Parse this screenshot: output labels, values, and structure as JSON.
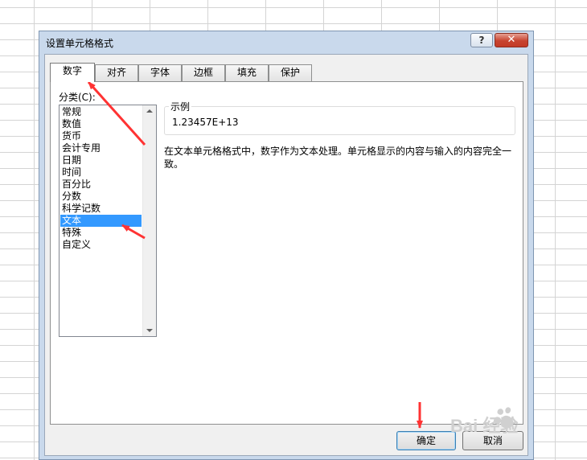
{
  "dialog": {
    "title": "设置单元格格式",
    "help_label": "?",
    "close_label": "✕"
  },
  "tabs": [
    {
      "label": "数字",
      "active": true
    },
    {
      "label": "对齐",
      "active": false
    },
    {
      "label": "字体",
      "active": false
    },
    {
      "label": "边框",
      "active": false
    },
    {
      "label": "填充",
      "active": false
    },
    {
      "label": "保护",
      "active": false
    }
  ],
  "category": {
    "label": "分类(C):",
    "items": [
      "常规",
      "数值",
      "货币",
      "会计专用",
      "日期",
      "时间",
      "百分比",
      "分数",
      "科学记数",
      "文本",
      "特殊",
      "自定义"
    ],
    "selected": "文本"
  },
  "sample": {
    "legend": "示例",
    "value": "1.23457E+13"
  },
  "description": "在文本单元格格式中，数字作为文本处理。单元格显示的内容与输入的内容完全一致。",
  "buttons": {
    "ok": "确定",
    "cancel": "取消"
  },
  "colors": {
    "selection": "#3399ff",
    "annotation_arrow": "#ff3333",
    "dialog_frame": "#c9d9ec"
  },
  "watermark": {
    "text": "Bai 经验"
  }
}
